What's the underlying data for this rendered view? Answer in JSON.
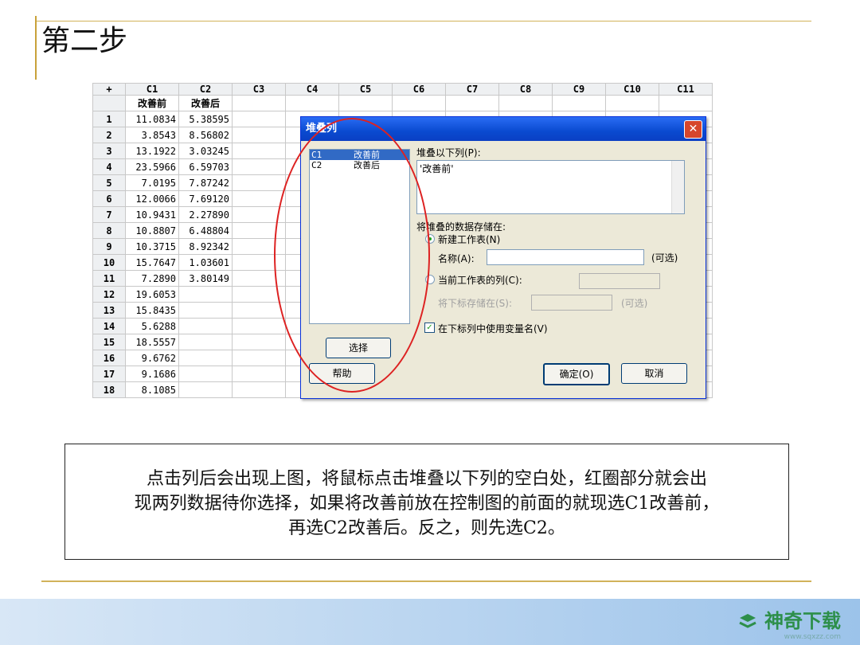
{
  "slide": {
    "title": "第二步",
    "description_lines": [
      "点击列后会出现上图，将鼠标点击堆叠以下列的空白处，红圈部分就会出",
      "现两列数据待你选择，如果将改善前放在控制图的前面的就现选C1改善前，",
      "再选C2改善后。反之，则先选C2。"
    ]
  },
  "sheet": {
    "corner": "+",
    "col_headers": [
      "C1",
      "C2",
      "C3",
      "C4",
      "C5",
      "C6",
      "C7",
      "C8",
      "C9",
      "C10",
      "C11"
    ],
    "col_names": [
      "改善前",
      "改善后"
    ],
    "rows": [
      {
        "n": "1",
        "c1": "11.0834",
        "c2": "5.38595"
      },
      {
        "n": "2",
        "c1": "3.8543",
        "c2": "8.56802"
      },
      {
        "n": "3",
        "c1": "13.1922",
        "c2": "3.03245"
      },
      {
        "n": "4",
        "c1": "23.5966",
        "c2": "6.59703"
      },
      {
        "n": "5",
        "c1": "7.0195",
        "c2": "7.87242"
      },
      {
        "n": "6",
        "c1": "12.0066",
        "c2": "7.69120"
      },
      {
        "n": "7",
        "c1": "10.9431",
        "c2": "2.27890"
      },
      {
        "n": "8",
        "c1": "10.8807",
        "c2": "6.48804"
      },
      {
        "n": "9",
        "c1": "10.3715",
        "c2": "8.92342"
      },
      {
        "n": "10",
        "c1": "15.7647",
        "c2": "1.03601"
      },
      {
        "n": "11",
        "c1": "7.2890",
        "c2": "3.80149"
      },
      {
        "n": "12",
        "c1": "19.6053",
        "c2": ""
      },
      {
        "n": "13",
        "c1": "15.8435",
        "c2": ""
      },
      {
        "n": "14",
        "c1": "5.6288",
        "c2": ""
      },
      {
        "n": "15",
        "c1": "18.5557",
        "c2": ""
      },
      {
        "n": "16",
        "c1": "9.6762",
        "c2": ""
      },
      {
        "n": "17",
        "c1": "9.1686",
        "c2": ""
      },
      {
        "n": "18",
        "c1": "8.1085",
        "c2": ""
      }
    ]
  },
  "dialog": {
    "title": "堆叠列",
    "close": "✕",
    "list_items": [
      "C1      改善前",
      "C2      改善后"
    ],
    "stack_label": "堆叠以下列(P):",
    "stack_value": "'改善前'",
    "store_label": "将堆叠的数据存储在:",
    "new_sheet_label": "新建工作表(N)",
    "name_label": "名称(A):",
    "optional_label": "(可选)",
    "current_sheet_label": "当前工作表的列(C):",
    "subscript_label": "将下标存储在(S):",
    "optional_label_2": "(可选)",
    "use_varnames_label": "在下标列中使用变量名(V)",
    "select_button": "选择",
    "help_button": "帮助",
    "ok_button": "确定(O)",
    "cancel_button": "取消"
  },
  "footer": {
    "logo_text": "神奇下载",
    "logo_url": "www.sqxzz.com"
  }
}
